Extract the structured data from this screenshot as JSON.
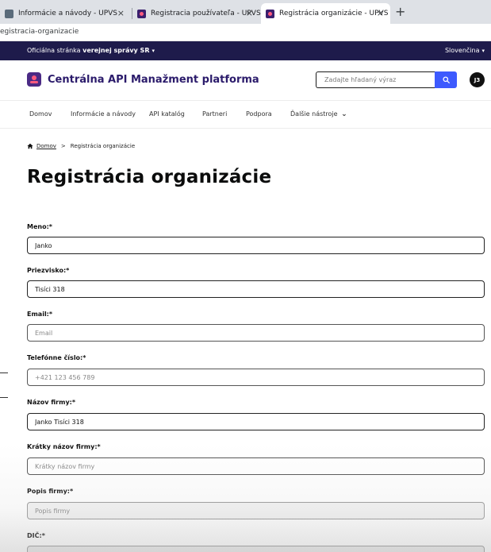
{
  "browser": {
    "tabs": [
      {
        "title": "Informácie a návody - UPVS",
        "active": false
      },
      {
        "title": "Registracia používateľa - UPVS",
        "active": false
      },
      {
        "title": "Registrácia organizácie - UPVS",
        "active": true
      }
    ],
    "close_glyph": "×",
    "newtab_glyph": "+",
    "address": "egistracia-organizacie"
  },
  "govbar": {
    "prefix": "Oficiálna stránka ",
    "bold": "verejnej správy SR",
    "caret": "▾",
    "language": "Slovenčina"
  },
  "header": {
    "title": "Centrálna API Manažment platforma",
    "search_placeholder": "Zadajte hľadaný výraz",
    "avatar_initials": "J3"
  },
  "nav": {
    "items": [
      "Domov",
      "Informácie a návody",
      "API katalóg",
      "Partneri",
      "Podpora",
      "Ďalšie nástroje"
    ],
    "dropdown_glyph": "⌄"
  },
  "breadcrumb": {
    "home": "Domov",
    "separator": ">",
    "current": "Registrácia organizácie"
  },
  "page": {
    "title": "Registrácia organizácie"
  },
  "form": {
    "fields": [
      {
        "label": "Meno:*",
        "value": "Janko",
        "placeholder": ""
      },
      {
        "label": "Priezvisko:*",
        "value": "Tisíci 318",
        "placeholder": ""
      },
      {
        "label": "Email:*",
        "value": "",
        "placeholder": "Email"
      },
      {
        "label": "Telefónne číslo:*",
        "value": "",
        "placeholder": "+421 123 456 789"
      },
      {
        "label": "Názov firmy:*",
        "value": "Janko Tisíci 318",
        "placeholder": ""
      },
      {
        "label": "Krátky názov firmy:*",
        "value": "",
        "placeholder": "Krátky názov firmy"
      },
      {
        "label": "Popis firmy:*",
        "value": "",
        "placeholder": "Popis firmy"
      },
      {
        "label": "DIČ:*",
        "value": "",
        "placeholder": ""
      }
    ]
  },
  "colors": {
    "govbar": "#1e1b4b",
    "brand_title": "#2b1b6b",
    "search_button": "#3d5afe",
    "accent_pink": "#ff5a7e"
  }
}
